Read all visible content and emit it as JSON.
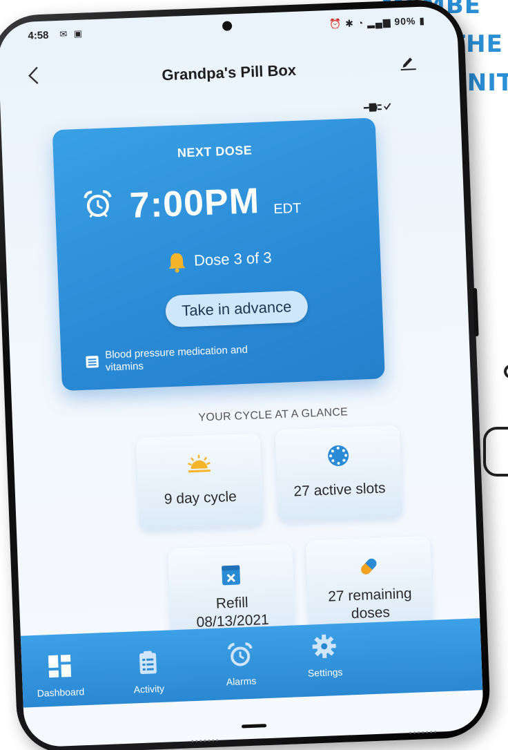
{
  "promo": {
    "line1": "MEMBE",
    "line2": "TO THE",
    "line3": "MONIT"
  },
  "status_bar": {
    "time": "4:58",
    "left_icons": "✉ ▣",
    "battery": "90%"
  },
  "app_bar": {
    "back_icon": "chevron-left-icon",
    "title": "Grandpa's Pill Box",
    "edit_icon": "pencil-icon",
    "connection_icon": "plug-check-icon"
  },
  "next_dose": {
    "label": "NEXT DOSE",
    "time": "7:00PM",
    "timezone": "EDT",
    "dose_count": "Dose 3 of 3",
    "advance_button": "Take in advance",
    "medication": "Blood pressure medication and vitamins"
  },
  "glance": {
    "title": "YOUR CYCLE AT A GLANCE",
    "tiles": [
      {
        "icon": "sun-icon",
        "label": "9 day cycle"
      },
      {
        "icon": "pill-wheel-icon",
        "label": "27 active slots"
      },
      {
        "icon": "calendar-x-icon",
        "label_line1": "Refill",
        "label_line2": "08/13/2021"
      },
      {
        "icon": "capsule-icon",
        "label_line1": "27 remaining",
        "label_line2": "doses"
      }
    ]
  },
  "bottom_nav": {
    "items": [
      {
        "icon": "dashboard-icon",
        "label": "Dashboard"
      },
      {
        "icon": "clipboard-icon",
        "label": "Activity"
      },
      {
        "icon": "alarm-clock-icon",
        "label": "Alarms"
      },
      {
        "icon": "gear-icon",
        "label": "Settings"
      }
    ]
  },
  "colors": {
    "accent": "#2a8ad6",
    "card_gradient_start": "#3aa0e4",
    "sun_yellow": "#f5b52a",
    "capsule_orange": "#f4a21d",
    "promo_text": "#2b8fd6"
  }
}
